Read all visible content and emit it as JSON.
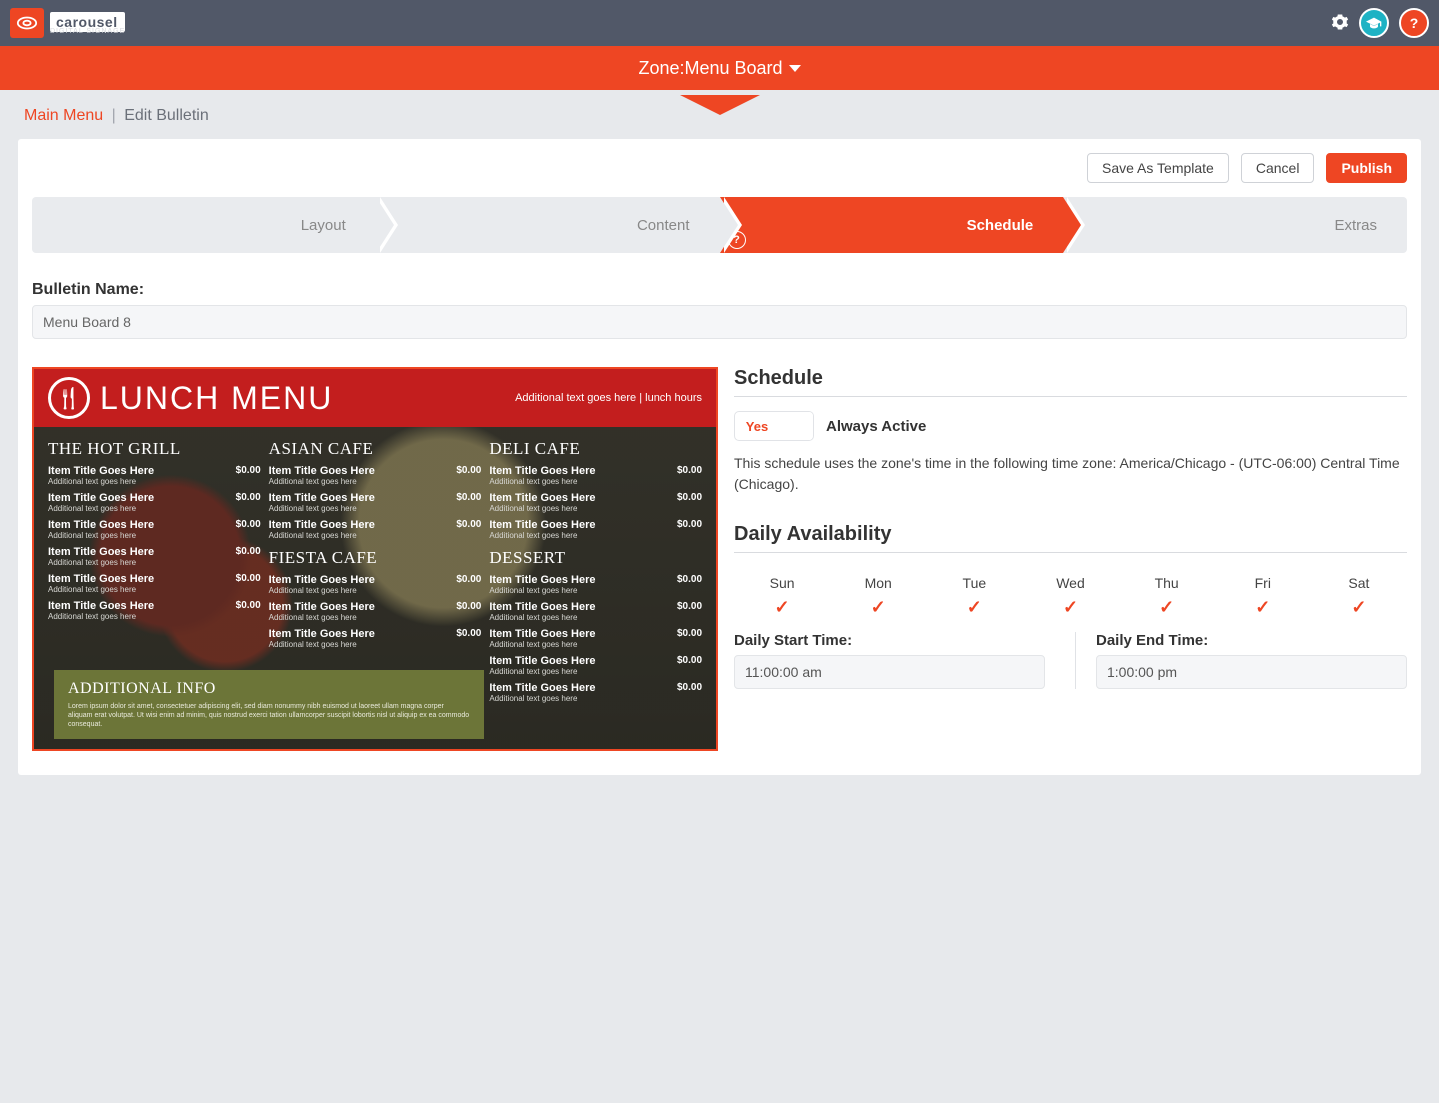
{
  "brand": {
    "name": "carousel",
    "tagline": "DIGITAL SIGNAGE"
  },
  "zone": {
    "prefix": "Zone: ",
    "name": "Menu Board"
  },
  "crumbs": {
    "main": "Main Menu",
    "sep": "|",
    "here": "Edit Bulletin"
  },
  "actions": {
    "save_template": "Save As Template",
    "cancel": "Cancel",
    "publish": "Publish"
  },
  "steps": {
    "layout": "Layout",
    "content": "Content",
    "schedule": "Schedule",
    "extras": "Extras",
    "help": "?"
  },
  "name_field": {
    "label": "Bulletin Name:",
    "value": "Menu Board 8"
  },
  "preview": {
    "title": "LUNCH MENU",
    "subtitle": "Additional text goes here | lunch hours",
    "cols": [
      {
        "head": "THE HOT GRILL",
        "items": 6
      },
      {
        "head": "ASIAN CAFE",
        "items": 3,
        "head2": "FIESTA CAFE",
        "items2": 3
      },
      {
        "head": "DELI CAFE",
        "items": 3,
        "head2": "DESSERT",
        "items2": 5
      }
    ],
    "item_title": "Item Title Goes Here",
    "item_desc": "Additional text goes here",
    "item_price": "$0.00",
    "info_head": "ADDITIONAL INFO",
    "info_body": "Lorem ipsum dolor sit amet, consectetuer adipiscing elit, sed diam nonummy nibh euismod ut laoreet ullam magna corper aliquam erat volutpat. Ut wisi enim ad minim, quis nostrud exerci tation ullamcorper suscipit lobortis nisl ut aliquip ex ea commodo consequat."
  },
  "schedule": {
    "title": "Schedule",
    "toggle_yes": "Yes",
    "toggle_label": "Always Active",
    "note": "This schedule uses the zone's time in the following time zone: America/Chicago - (UTC-06:00) Central Time (Chicago)."
  },
  "availability": {
    "title": "Daily Availability",
    "days": [
      "Sun",
      "Mon",
      "Tue",
      "Wed",
      "Thu",
      "Fri",
      "Sat"
    ],
    "start_label": "Daily Start Time:",
    "start_value": "11:00:00 am",
    "end_label": "Daily End Time:",
    "end_value": "1:00:00 pm"
  }
}
